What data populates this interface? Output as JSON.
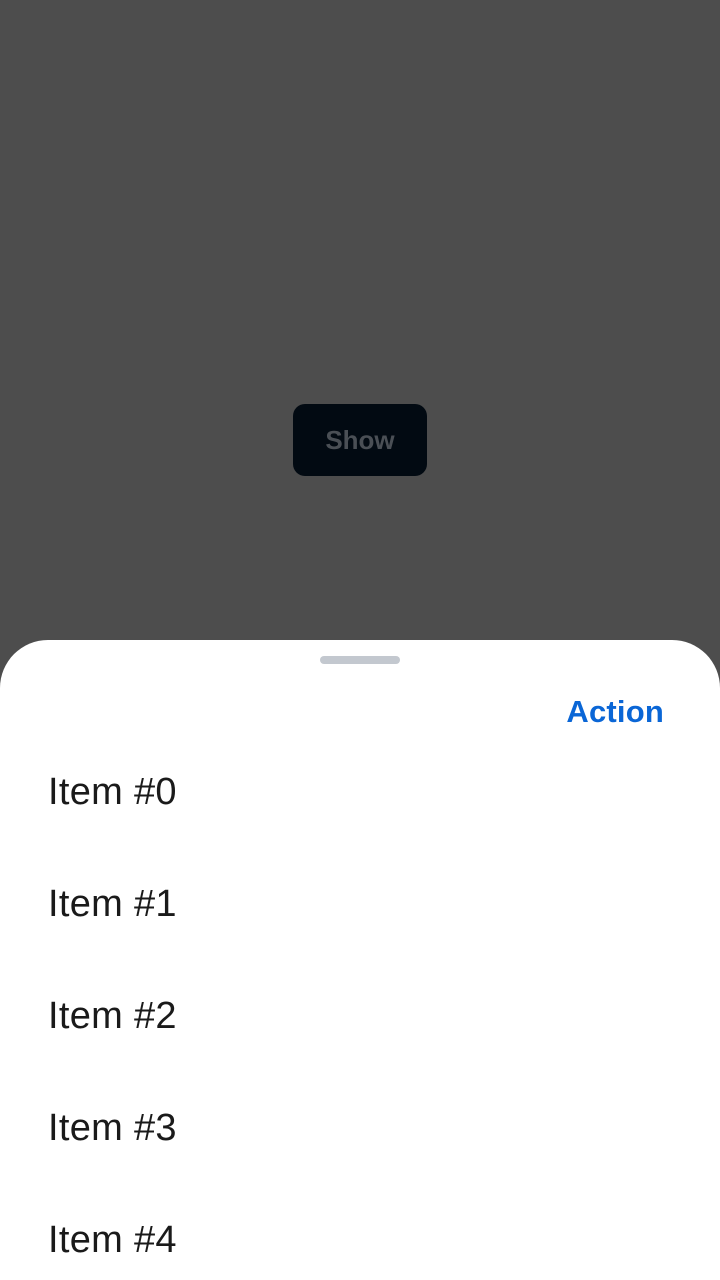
{
  "background": {
    "show_button_label": "Show"
  },
  "sheet": {
    "action_label": "Action",
    "items": [
      {
        "label": "Item #0"
      },
      {
        "label": "Item #1"
      },
      {
        "label": "Item #2"
      },
      {
        "label": "Item #3"
      },
      {
        "label": "Item #4"
      }
    ]
  },
  "colors": {
    "scrim": "#4d4d4d",
    "action_accent": "#0a66d6",
    "handle": "#c3c8cf"
  }
}
